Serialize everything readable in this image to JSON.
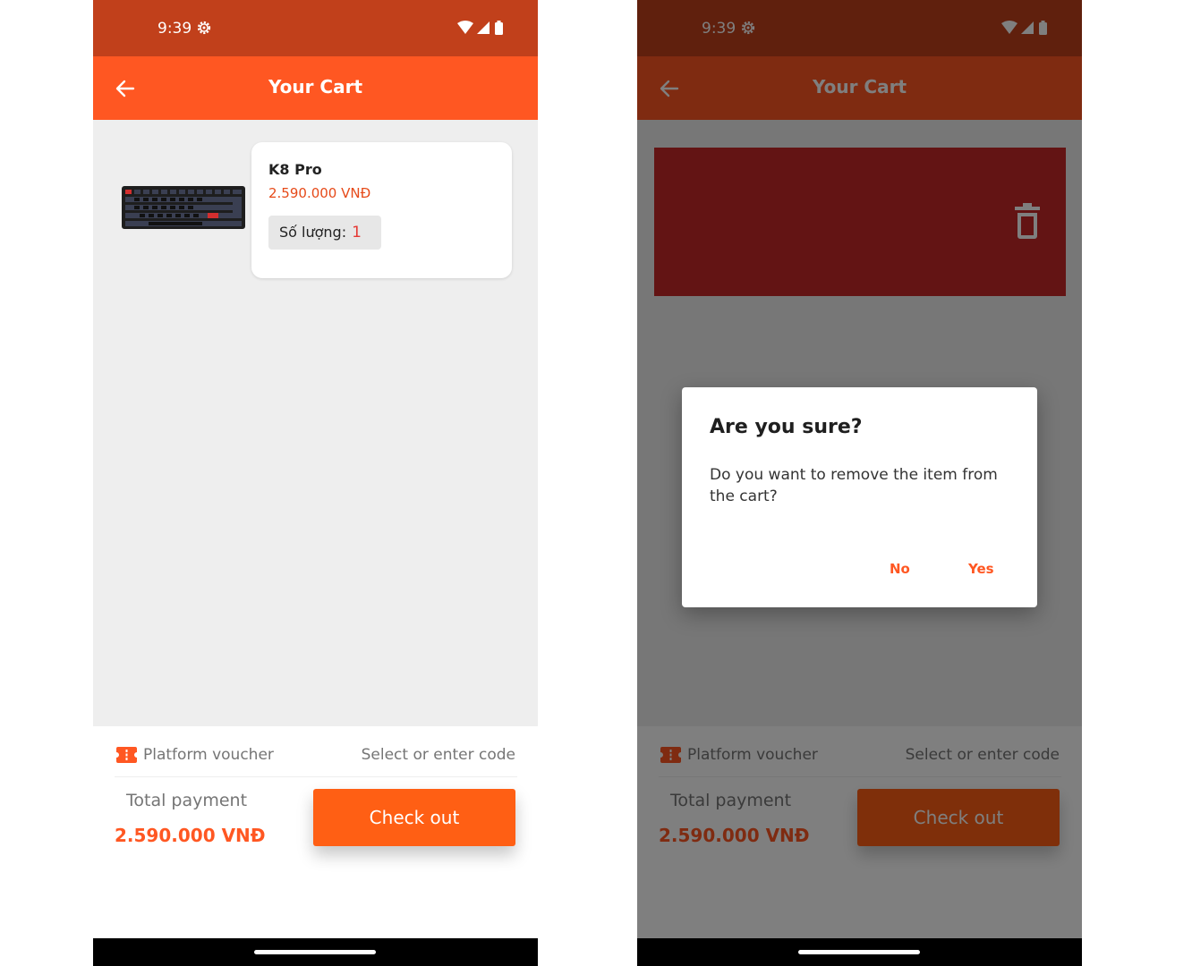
{
  "status_bar": {
    "time": "9:39"
  },
  "app_bar": {
    "title": "Your Cart",
    "back_icon": "arrow-left-icon"
  },
  "cart": {
    "items": [
      {
        "name": "K8 Pro",
        "price": "2.590.000 VNĐ",
        "quantity_label": "Số lượng:",
        "quantity": "1",
        "image": "keyboard-image"
      }
    ]
  },
  "voucher": {
    "label": "Platform voucher",
    "action": "Select or enter code",
    "icon": "ticket-icon"
  },
  "summary": {
    "total_label": "Total payment",
    "total_value": "2.590.000 VNĐ",
    "checkout_label": "Check out"
  },
  "dialog": {
    "title": "Are you sure?",
    "message": "Do you want to remove the item from the cart?",
    "no_label": "No",
    "yes_label": "Yes"
  },
  "swipe": {
    "icon": "trash-icon"
  },
  "colors": {
    "primary": "#ff5722",
    "status_bar": "#c1401b",
    "checkout": "#ff5f14",
    "dismiss": "#c62828",
    "price": "#e64a19"
  }
}
